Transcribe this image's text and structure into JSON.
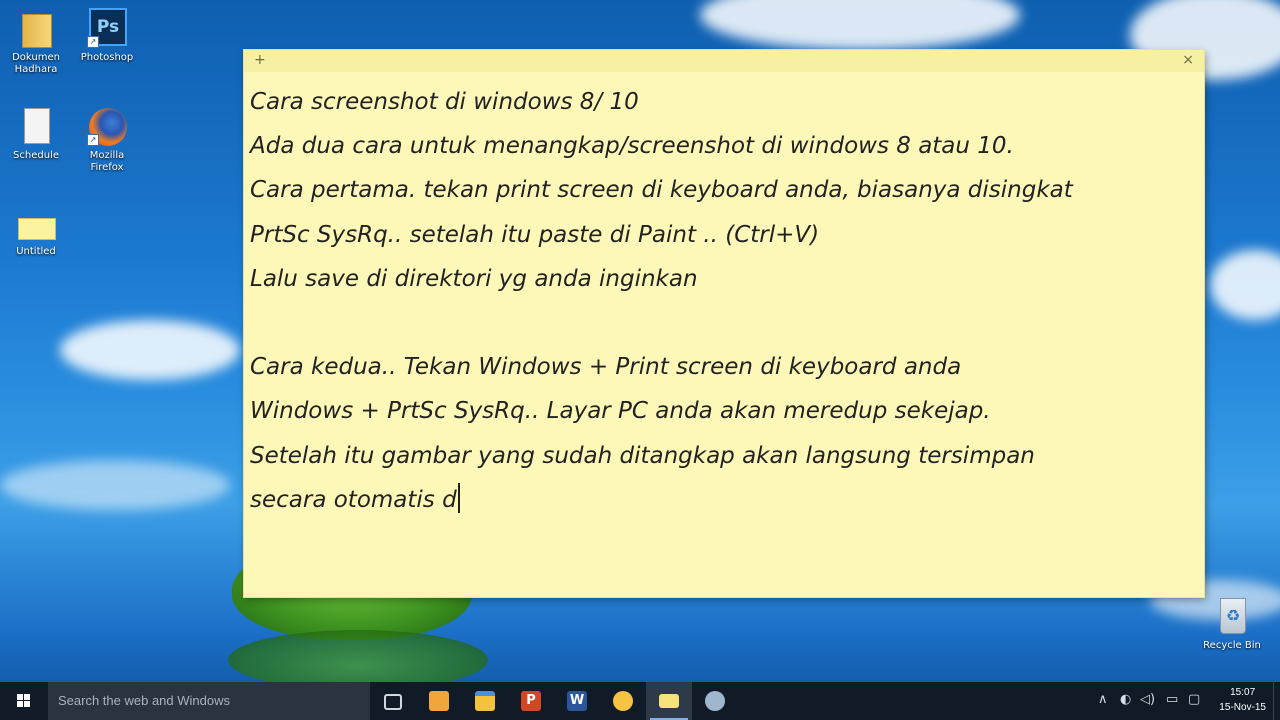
{
  "desktop": {
    "icons": [
      {
        "label": "Dokumen Hadhara",
        "icon": "folder-icon"
      },
      {
        "label": "Photoshop",
        "icon": "photoshop-icon",
        "glyph": "Ps"
      },
      {
        "label": "Schedule",
        "icon": "document-icon"
      },
      {
        "label": "Mozilla Firefox",
        "icon": "firefox-icon"
      },
      {
        "label": "Untitled",
        "icon": "sticky-notes-icon"
      },
      {
        "label": "Recycle Bin",
        "icon": "recycle-bin-icon"
      }
    ]
  },
  "note": {
    "add_glyph": "+",
    "close_glyph": "×",
    "lines": [
      "Cara screenshot di windows 8/ 10",
      "Ada dua cara untuk menangkap/screenshot di windows 8 atau 10.",
      "Cara pertama. tekan print screen di keyboard anda, biasanya disingkat",
      "PrtSc SysRq.. setelah itu paste di Paint .. (Ctrl+V)",
      "Lalu save di direktori yg anda inginkan",
      "",
      "Cara kedua.. Tekan Windows + Print screen di keyboard anda",
      "Windows + PrtSc SysRq.. Layar PC anda akan meredup sekejap.",
      "Setelah itu gambar yang sudah ditangkap akan langsung tersimpan",
      "secara otomatis d"
    ]
  },
  "taskbar": {
    "search_placeholder": "Search the web and Windows",
    "apps": [
      {
        "name": "task-view",
        "color": "#1e2a38"
      },
      {
        "name": "sticky-app",
        "color": "#f3a53a"
      },
      {
        "name": "file-explorer",
        "color": "#f2c33b"
      },
      {
        "name": "powerpoint",
        "color": "#d24726"
      },
      {
        "name": "word",
        "color": "#2b579a"
      },
      {
        "name": "app-yellow",
        "color": "#f6c342"
      },
      {
        "name": "sticky-notes",
        "color": "#f6e27a"
      },
      {
        "name": "settings",
        "color": "#9fb7cc"
      }
    ],
    "tray": {
      "up_arrow": "∧",
      "network": "◐",
      "volume": "◁)",
      "keyboard": "▭",
      "message": "▢"
    },
    "clock": {
      "time": "15:07",
      "date": "15-Nov-15"
    }
  }
}
